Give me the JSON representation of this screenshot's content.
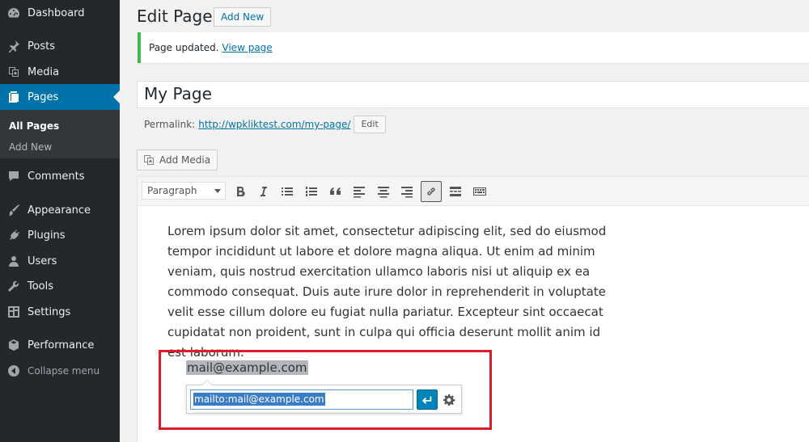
{
  "sidebar": {
    "items": [
      {
        "label": "Dashboard",
        "icon": "dashboard-icon"
      },
      {
        "label": "Posts",
        "icon": "pin-icon"
      },
      {
        "label": "Media",
        "icon": "media-icon"
      },
      {
        "label": "Pages",
        "icon": "pages-icon"
      },
      {
        "label": "Comments",
        "icon": "comment-icon"
      },
      {
        "label": "Appearance",
        "icon": "brush-icon"
      },
      {
        "label": "Plugins",
        "icon": "plug-icon"
      },
      {
        "label": "Users",
        "icon": "user-icon"
      },
      {
        "label": "Tools",
        "icon": "wrench-icon"
      },
      {
        "label": "Settings",
        "icon": "settings-icon"
      },
      {
        "label": "Performance",
        "icon": "cube-icon"
      }
    ],
    "submenu": [
      "All Pages",
      "Add New"
    ],
    "collapse_label": "Collapse menu"
  },
  "header": {
    "title": "Edit Page",
    "add_new_label": "Add New"
  },
  "notice": {
    "text": "Page updated.",
    "link": "View page"
  },
  "post": {
    "title": "My Page"
  },
  "permalink": {
    "label": "Permalink:",
    "url": "http://wpkliktest.com/my-page/",
    "edit_label": "Edit"
  },
  "media": {
    "add_label": "Add Media"
  },
  "toolbar": {
    "format_value": "Paragraph"
  },
  "content": {
    "paragraph": "Lorem ipsum dolor sit amet, consectetur adipiscing elit, sed do eiusmod tempor incididunt ut labore et dolore magna aliqua. Ut enim ad minim veniam, quis nostrud exercitation ullamco laboris nisi ut aliquip ex ea commodo consequat. Duis aute irure dolor in reprehenderit in voluptate velit esse cillum dolore eu fugiat nulla pariatur. Excepteur sint occaecat cupidatat non proident, sunt in culpa qui officia deserunt mollit anim id est laborum.",
    "selected_link_text": "mail@example.com",
    "link_url": "mailto:mail@example.com"
  },
  "colors": {
    "accent": "#0073aa",
    "sidebar_bg": "#23282d",
    "highlight": "#dd1c2a",
    "notice_success": "#46b450"
  }
}
